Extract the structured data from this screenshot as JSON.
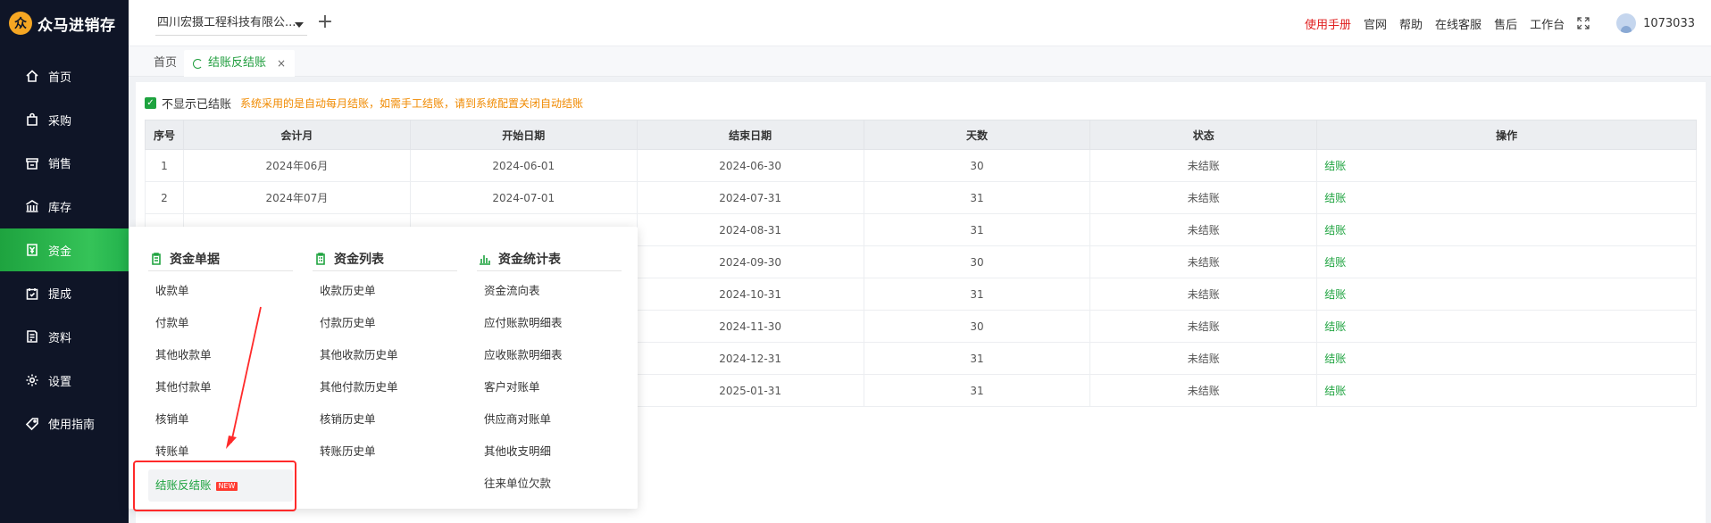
{
  "app": {
    "logo_mark": "众",
    "name": "众马进销存"
  },
  "sidebar": {
    "items": [
      {
        "label": "首页",
        "icon": "home-icon"
      },
      {
        "label": "采购",
        "icon": "bag-icon"
      },
      {
        "label": "销售",
        "icon": "store-icon"
      },
      {
        "label": "库存",
        "icon": "warehouse-icon"
      },
      {
        "label": "资金",
        "icon": "money-icon",
        "active": true
      },
      {
        "label": "提成",
        "icon": "commission-icon"
      },
      {
        "label": "资料",
        "icon": "document-icon"
      },
      {
        "label": "设置",
        "icon": "gear-icon"
      },
      {
        "label": "使用指南",
        "icon": "tag-icon"
      }
    ]
  },
  "topbar": {
    "company": "四川宏摄工程科技有限公...",
    "add": "+",
    "links": {
      "manual": "使用手册",
      "official": "官网",
      "help": "帮助",
      "service": "在线客服",
      "after_sales": "售后",
      "workbench": "工作台"
    },
    "user_id": "1073033"
  },
  "tabs": {
    "home": "首页",
    "active": "结账反结账",
    "close": "×"
  },
  "page": {
    "checkbox_check": "✓",
    "hide_closed_label": "不显示已结账",
    "tip": "系统采用的是自动每月结账，如需手工结账，请到系统配置关闭自动结账"
  },
  "table": {
    "headers": [
      "序号",
      "会计月",
      "开始日期",
      "结束日期",
      "天数",
      "状态",
      "操作"
    ],
    "rows": [
      [
        "1",
        "2024年06月",
        "2024-06-01",
        "2024-06-30",
        "30",
        "未结账",
        "结账"
      ],
      [
        "2",
        "2024年07月",
        "2024-07-01",
        "2024-07-31",
        "31",
        "未结账",
        "结账"
      ],
      [
        "",
        "",
        "",
        "2024-08-31",
        "31",
        "未结账",
        "结账"
      ],
      [
        "",
        "",
        "",
        "2024-09-30",
        "30",
        "未结账",
        "结账"
      ],
      [
        "",
        "",
        "",
        "2024-10-31",
        "31",
        "未结账",
        "结账"
      ],
      [
        "",
        "",
        "",
        "2024-11-30",
        "30",
        "未结账",
        "结账"
      ],
      [
        "",
        "",
        "",
        "2024-12-31",
        "31",
        "未结账",
        "结账"
      ],
      [
        "",
        "",
        "",
        "2025-01-31",
        "31",
        "未结账",
        "结账"
      ]
    ]
  },
  "menu": {
    "columns": [
      {
        "title": "资金单据",
        "items": [
          "收款单",
          "付款单",
          "其他收款单",
          "其他付款单",
          "核销单",
          "转账单"
        ],
        "selected": "结账反结账",
        "badge": "NEW"
      },
      {
        "title": "资金列表",
        "items": [
          "收款历史单",
          "付款历史单",
          "其他收款历史单",
          "其他付款历史单",
          "核销历史单",
          "转账历史单"
        ]
      },
      {
        "title": "资金统计表",
        "items": [
          "资金流向表",
          "应付账款明细表",
          "应收账款明细表",
          "客户对账单",
          "供应商对账单",
          "其他收支明细",
          "往来单位欠款"
        ]
      }
    ]
  },
  "colors": {
    "accent": "#1ea33f",
    "sidebar_bg": "#0f1527",
    "manual_link": "#e02020",
    "tip": "#f08a00",
    "annotation": "#ff2a2a"
  }
}
